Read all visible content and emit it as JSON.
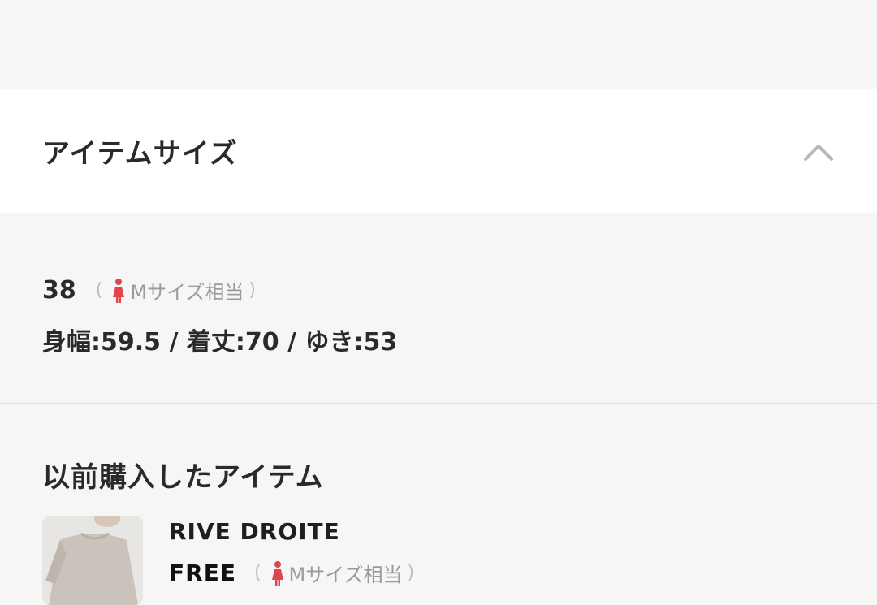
{
  "section": {
    "title": "アイテムサイズ",
    "toggle_icon": "chevron-up-icon"
  },
  "my_size": {
    "size": "38",
    "note_open": "(",
    "note_text": "Mサイズ相当",
    "note_close": ")",
    "icon": "female-icon",
    "icon_color": "#e0474c",
    "measurements": "身幅:59.5 / 着丈:70 / ゆき:53"
  },
  "previous": {
    "title": "以前購入したアイテム",
    "items": [
      {
        "brand": "RIVE DROITE",
        "size": "FREE",
        "note_open": "(",
        "note_text": "Mサイズ相当",
        "note_close": ")",
        "icon": "female-icon"
      }
    ]
  }
}
